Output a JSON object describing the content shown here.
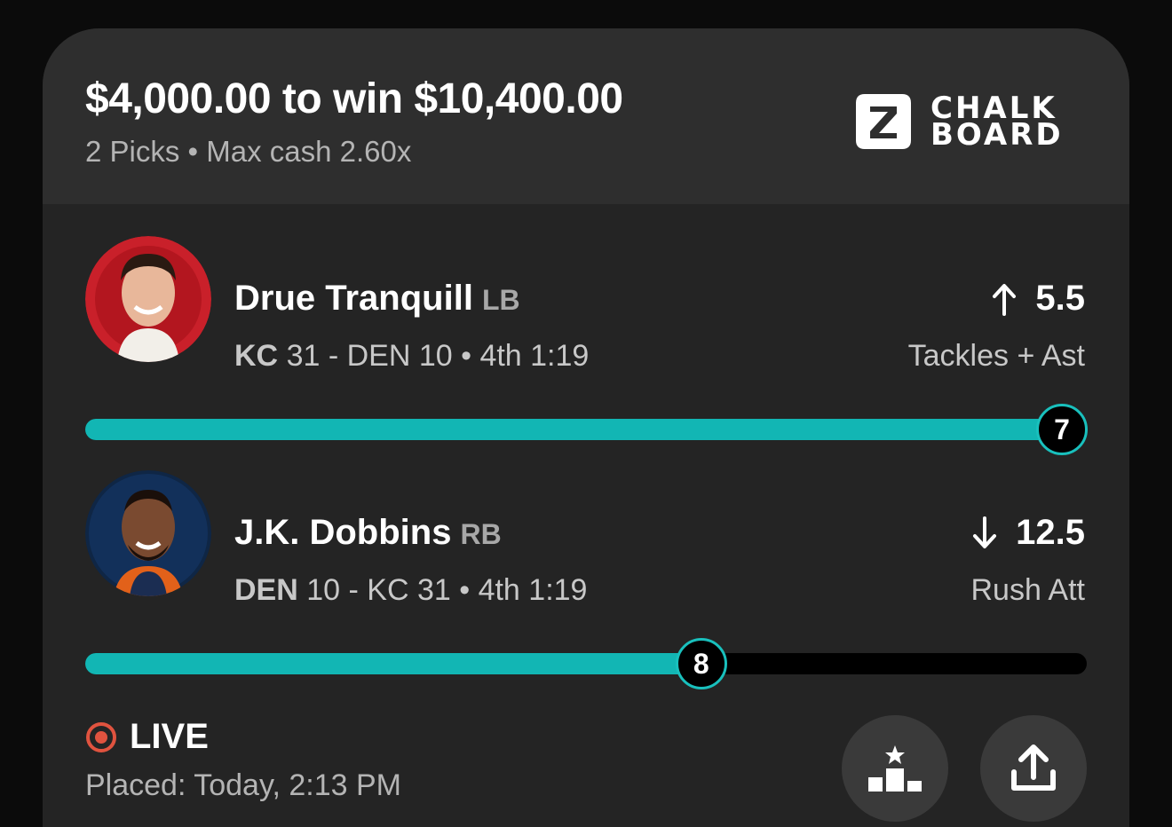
{
  "header": {
    "wager": "$4,000.00 to win $10,400.00",
    "subtitle": "2 Picks • Max cash 2.60x",
    "logo": {
      "text_line1": "CHALK",
      "text_line2": "BOARD"
    }
  },
  "picks": [
    {
      "player": "Drue Tranquill",
      "position": "LB",
      "team": "KC",
      "game_rest": "31 - DEN 10 • 4th 1:19",
      "direction": "over",
      "direction_icon": "arrow-up-icon",
      "line": "5.5",
      "stat": "Tackles + Ast",
      "current": "7",
      "progress": 1.0,
      "avatar_color": "#c9202a"
    },
    {
      "player": "J.K. Dobbins",
      "position": "RB",
      "team": "DEN",
      "game_rest": "10 - KC 31 • 4th 1:19",
      "direction": "under",
      "direction_icon": "arrow-down-icon",
      "line": "12.5",
      "stat": "Rush Att",
      "current": "8",
      "progress": 0.615,
      "avatar_color": "#0f2645"
    }
  ],
  "footer": {
    "status": "LIVE",
    "placed": "Placed: Today, 2:13 PM",
    "leaderboard_icon": "podium-icon",
    "share_icon": "share-icon"
  },
  "colors": {
    "accent": "#12b6b4",
    "live": "#e0533f",
    "background": "#242424"
  }
}
